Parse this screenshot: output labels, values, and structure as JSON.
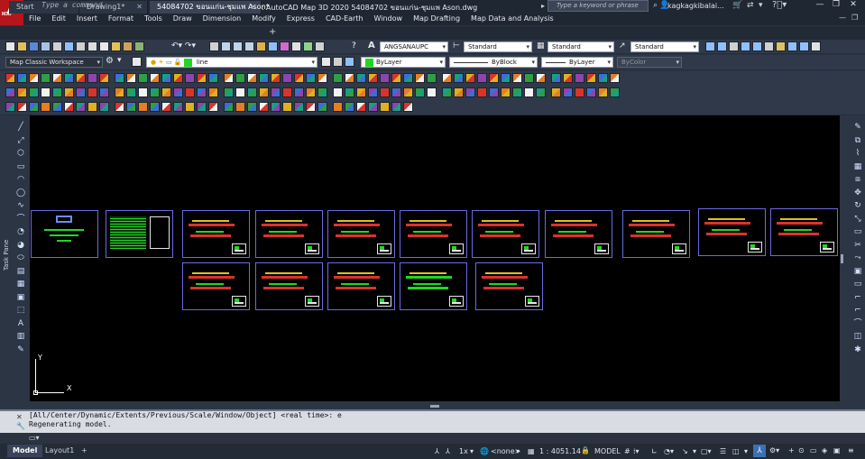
{
  "app": {
    "logo_text": "A",
    "logo_sub": "M3D",
    "title": "Autodesk AutoCAD Map 3D 2020    54084702 ขอนแก่น-ชุมแพ Ason.dwg",
    "search_placeholder": "Type a keyword or phrase",
    "user": "kagkagkibalai...",
    "window_minimize": "—",
    "window_restore": "❐",
    "window_close": "✕"
  },
  "menu": [
    "File",
    "Edit",
    "Insert",
    "Format",
    "Tools",
    "Draw",
    "Dimension",
    "Modify",
    "Express",
    "CAD-Earth",
    "Window",
    "Map Drafting",
    "Map Data and Analysis"
  ],
  "tabs": [
    {
      "label": "Start"
    },
    {
      "label": "Drawing1*"
    },
    {
      "label": "54084702 ขอนแก่น-ชุมแพ Ason*"
    }
  ],
  "toolbar": {
    "text_style": "ANGSANAUPC",
    "dim_style": "Standard",
    "table_style": "Standard",
    "multileader_style": "Standard",
    "workspace": "Map Classic Workspace",
    "layer": "line",
    "color": "ByLayer",
    "linetype": "ByBlock",
    "lineweight": "ByLayer",
    "plotstyle": "ByColor",
    "colors": {
      "layer_swatch": "#23d623",
      "color_swatch": "#23d623"
    }
  },
  "side": {
    "task_pane_label": "Task Pane"
  },
  "ucs": {
    "x": "X",
    "y": "Y"
  },
  "command": {
    "history": [
      "[All/Center/Dynamic/Extents/Previous/Scale/Window/Object] <real time>: e",
      "Regenerating model."
    ],
    "placeholder": "Type a command"
  },
  "status": {
    "model_tab": "Model",
    "layout_tab": "Layout1",
    "add_tab": "+",
    "annoscale_factor": "1x",
    "none_select": "<none>",
    "scale": "1 : 4051.14",
    "space": "MODEL"
  }
}
